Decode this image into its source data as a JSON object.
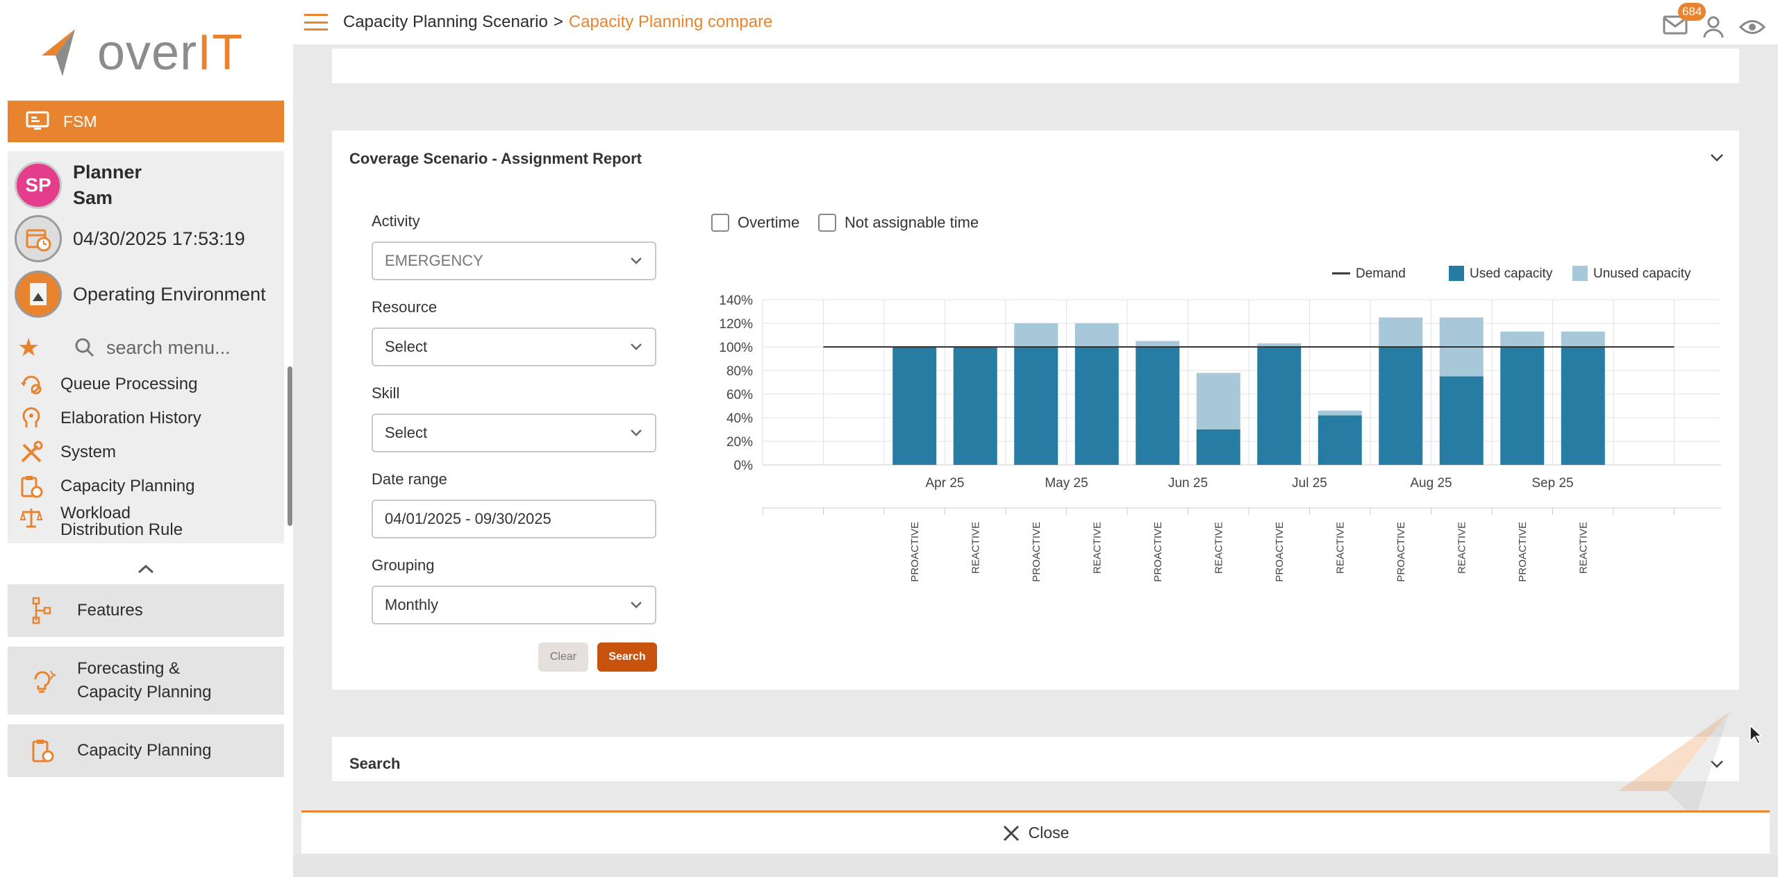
{
  "app": {
    "logo_text_main": "over",
    "logo_text_accent": "IT"
  },
  "sidebar": {
    "module": "FSM",
    "user": {
      "initials": "SP",
      "first_line": "Planner",
      "second_line": "Sam"
    },
    "datetime": "04/30/2025 17:53:19",
    "environment": "Operating Environment",
    "search_placeholder": "search menu...",
    "menu": [
      {
        "label": "Queue Processing",
        "icon": "queue-processing-icon"
      },
      {
        "label": "Elaboration History",
        "icon": "elaboration-history-icon"
      },
      {
        "label": "System",
        "icon": "tools-icon"
      },
      {
        "label": "Capacity Planning",
        "icon": "clipboard-clock-icon"
      },
      {
        "label": "Workload",
        "label2": "Distribution Rule",
        "icon": "scale-icon"
      }
    ],
    "features": [
      {
        "label": "Features",
        "icon": "sitemap-icon"
      },
      {
        "label": "Forecasting &",
        "label2": "Capacity Planning",
        "icon": "lightbulb-icon"
      },
      {
        "label": "Capacity Planning",
        "icon": "clipboard-clock-icon"
      }
    ]
  },
  "header": {
    "breadcrumb_parent": "Capacity Planning Scenario",
    "breadcrumb_separator": ">",
    "breadcrumb_current": "Capacity Planning compare",
    "notification_count": "684"
  },
  "panel": {
    "title": "Coverage Scenario - Assignment Report",
    "filters": {
      "activity_label": "Activity",
      "activity_value": "EMERGENCY",
      "resource_label": "Resource",
      "resource_value": "Select",
      "skill_label": "Skill",
      "skill_value": "Select",
      "date_label": "Date range",
      "date_value": "04/01/2025 - 09/30/2025",
      "grouping_label": "Grouping",
      "grouping_value": "Monthly"
    },
    "buttons": {
      "clear": "Clear",
      "search": "Search"
    },
    "checkboxes": {
      "overtime": "Overtime",
      "not_assignable": "Not assignable time"
    }
  },
  "search_panel": {
    "title": "Search"
  },
  "close_bar": {
    "label": "Close"
  },
  "colors": {
    "accent": "#e8842f",
    "used": "#277ca3",
    "unused": "#a6c8d8",
    "demand": "#333333",
    "search_button": "#c8530f"
  },
  "chart_data": {
    "type": "bar",
    "stacked": true,
    "legend": [
      "Demand",
      "Used capacity",
      "Unused capacity"
    ],
    "legend_position": "top-right",
    "ylim": [
      0,
      140
    ],
    "yticks": [
      "0%",
      "20%",
      "40%",
      "60%",
      "80%",
      "100%",
      "120%",
      "140%"
    ],
    "months": [
      "Apr 25",
      "May 25",
      "Jun 25",
      "Jul 25",
      "Aug 25",
      "Sep 25"
    ],
    "subcategories": [
      "PROACTIVE",
      "REACTIVE"
    ],
    "demand": 100,
    "series": [
      {
        "name": "Used capacity",
        "values": [
          100,
          100,
          100,
          100,
          100,
          30,
          100,
          42,
          100,
          75,
          100,
          100
        ]
      },
      {
        "name": "Unused capacity",
        "values": [
          0,
          0,
          20,
          20,
          5,
          48,
          3,
          4,
          25,
          50,
          13,
          13
        ]
      }
    ],
    "grid": true
  }
}
